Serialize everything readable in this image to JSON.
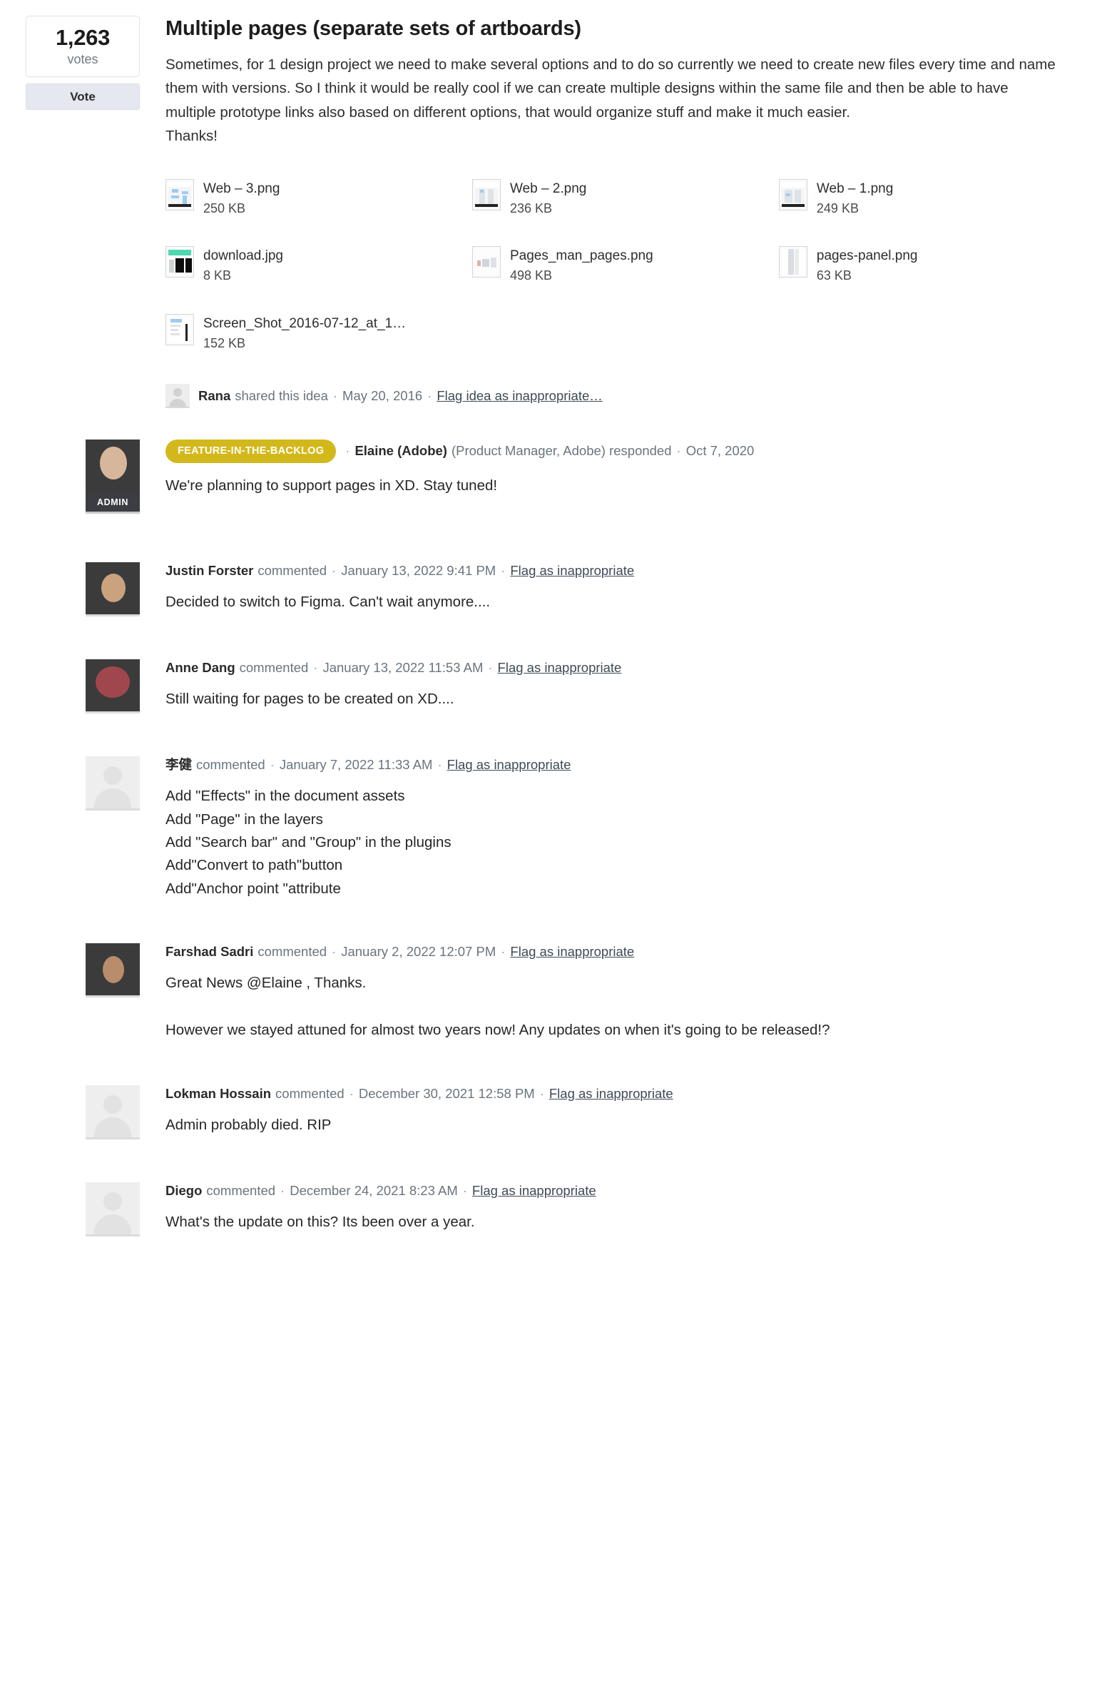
{
  "vote": {
    "count": "1,263",
    "label": "votes",
    "button": "Vote"
  },
  "idea": {
    "title": "Multiple pages (separate sets of artboards)",
    "body": "Sometimes, for 1 design project we need to make several options and to do so currently we need to create new files every time and name them with versions. So I think it would be really cool if we can create multiple designs within the same file and then be able to have multiple prototype links also based on different options, that would organize stuff and make it much easier.",
    "body_closing": "Thanks!",
    "shared_by": "Rana",
    "shared_action": "shared this idea",
    "shared_date": "May 20, 2016",
    "flag_link": "Flag idea as inappropriate…"
  },
  "attachments": [
    {
      "name": "Web – 3.png",
      "size": "250 KB",
      "kind": "web3"
    },
    {
      "name": "Web – 2.png",
      "size": "236 KB",
      "kind": "web2"
    },
    {
      "name": "Web – 1.png",
      "size": "249 KB",
      "kind": "web1"
    },
    {
      "name": "download.jpg",
      "size": "8 KB",
      "kind": "download"
    },
    {
      "name": "Pages_man_pages.png",
      "size": "498 KB",
      "kind": "pagesman"
    },
    {
      "name": "pages-panel.png",
      "size": "63 KB",
      "kind": "panel"
    },
    {
      "name": "Screen_Shot_2016-07-12_at_1…",
      "size": "152 KB",
      "kind": "screenshot"
    }
  ],
  "response": {
    "status": "FEATURE-IN-THE-BACKLOG",
    "author": "Elaine (Adobe)",
    "role": "(Product Manager, Adobe) responded",
    "date": "Oct 7, 2020",
    "text": "We're planning to support pages in XD. Stay tuned!",
    "admin_tag": "ADMIN",
    "badge_color": "#d3b81b"
  },
  "comment_meta": {
    "action": "commented",
    "flag_link": "Flag as inappropriate",
    "separator": "·"
  },
  "comments": [
    {
      "author": "Justin Forster",
      "date": "January 13, 2022 9:41 PM",
      "lines": [
        "Decided to switch to Figma. Can't wait anymore...."
      ],
      "avatar": "photo-face1"
    },
    {
      "author": "Anne Dang",
      "date": "January 13, 2022 11:53 AM",
      "lines": [
        "Still waiting for pages to be created on XD...."
      ],
      "avatar": "photo-face2"
    },
    {
      "author": "李健",
      "date": "January 7, 2022 11:33 AM",
      "lines": [
        "Add \"Effects\" in the document assets",
        "Add \"Page\" in the layers",
        "Add \"Search bar\" and \"Group\" in the plugins",
        "Add\"Convert to path\"button",
        "Add\"Anchor point \"attribute"
      ],
      "avatar": "generic"
    },
    {
      "author": "Farshad Sadri",
      "date": "January 2, 2022 12:07 PM",
      "lines": [
        "Great News @Elaine , Thanks.",
        "However we stayed attuned for almost two years now! Any updates on when it's going to be released!?"
      ],
      "avatar": "photo-face3",
      "gap_after_first": true
    },
    {
      "author": "Lokman Hossain",
      "date": "December 30, 2021 12:58 PM",
      "lines": [
        "Admin probably died. RIP"
      ],
      "avatar": "generic"
    },
    {
      "author": "Diego",
      "date": "December 24, 2021 8:23 AM",
      "lines": [
        "What's the update on this? Its been over a year."
      ],
      "avatar": "generic"
    }
  ]
}
